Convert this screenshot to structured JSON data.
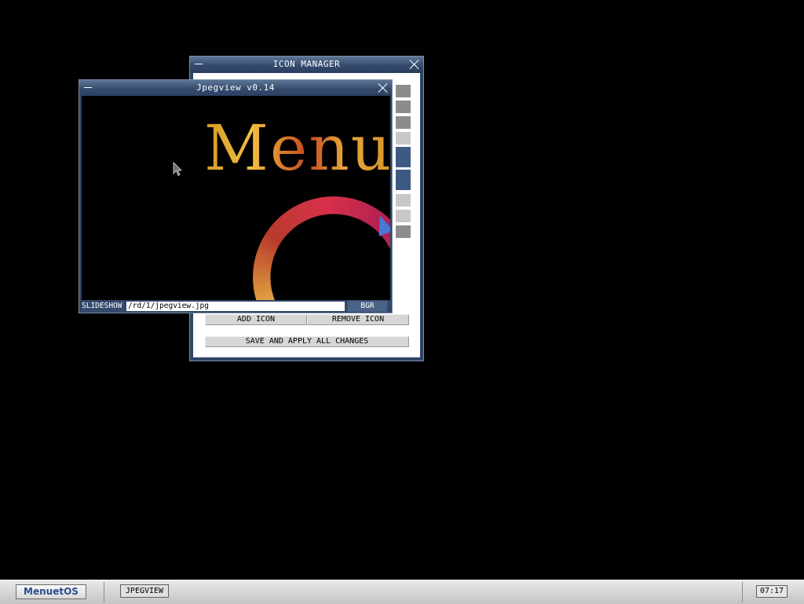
{
  "icon_manager": {
    "title": "ICON MANAGER",
    "add_icon": "ADD ICON",
    "remove_icon": "REMOVE ICON",
    "save_apply": "SAVE AND APPLY ALL CHANGES"
  },
  "jpegview": {
    "title": "Jpegview v0.14",
    "image_text": "Menu",
    "slideshow_label": "SLIDESHOW",
    "path_value": "/rd/1/jpegview.jpg",
    "bgr_label": "BGR"
  },
  "taskbar": {
    "start_label": "MenuetOS",
    "task_label": "JPEGVIEW",
    "clock": "07:17"
  },
  "colors": {
    "desktop": "#000000",
    "titlebar": "#33496b",
    "accent": "#2a4d8c"
  }
}
